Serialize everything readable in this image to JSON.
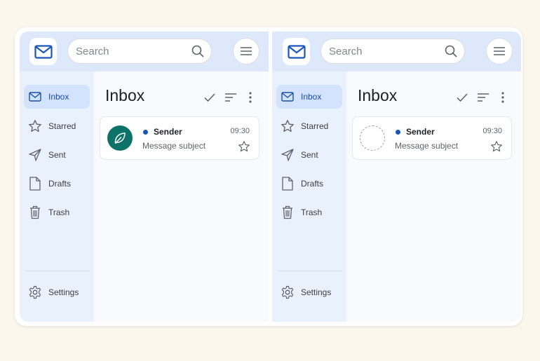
{
  "panels": [
    {
      "variant": "with-avatar",
      "search": {
        "placeholder": "Search"
      },
      "nav": [
        {
          "label": "Inbox",
          "icon": "mail-icon",
          "active": true
        },
        {
          "label": "Starred",
          "icon": "star-icon",
          "active": false
        },
        {
          "label": "Sent",
          "icon": "send-icon",
          "active": false
        },
        {
          "label": "Drafts",
          "icon": "draft-icon",
          "active": false
        },
        {
          "label": "Trash",
          "icon": "trash-icon",
          "active": false
        }
      ],
      "settings_label": "Settings",
      "main": {
        "title": "Inbox"
      },
      "message": {
        "sender": "Sender",
        "time": "09:30",
        "subject": "Message subject",
        "unread": true,
        "avatar": "leaf-icon"
      }
    },
    {
      "variant": "placeholder-avatar",
      "search": {
        "placeholder": "Search"
      },
      "nav": [
        {
          "label": "Inbox",
          "icon": "mail-icon",
          "active": true
        },
        {
          "label": "Starred",
          "icon": "star-icon",
          "active": false
        },
        {
          "label": "Sent",
          "icon": "send-icon",
          "active": false
        },
        {
          "label": "Drafts",
          "icon": "draft-icon",
          "active": false
        },
        {
          "label": "Trash",
          "icon": "trash-icon",
          "active": false
        }
      ],
      "settings_label": "Settings",
      "main": {
        "title": "Inbox"
      },
      "message": {
        "sender": "Sender",
        "time": "09:30",
        "subject": "Message subject",
        "unread": true,
        "avatar": "empty"
      }
    }
  ],
  "colors": {
    "page_background": "#fcf7ec",
    "topbar": "#dde9fb",
    "sidebar": "#e9f1fd",
    "active_nav": "#d3e3fd",
    "accent": "#1a56b7",
    "avatar": "#0d7268"
  }
}
